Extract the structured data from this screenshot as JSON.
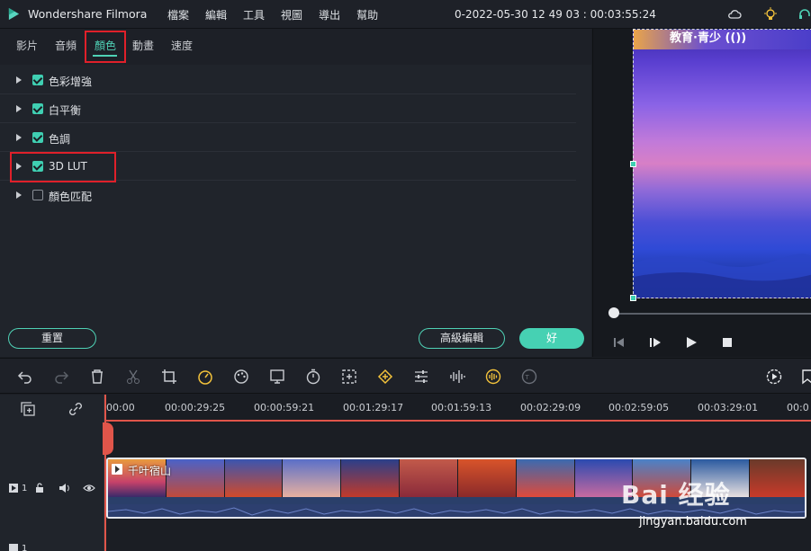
{
  "app": {
    "name": "Wondershare Filmora",
    "project_title": "0-2022-05-30 12 49 03 : 00:03:55:24"
  },
  "menu": [
    "檔案",
    "編輯",
    "工具",
    "視圖",
    "導出",
    "幫助"
  ],
  "tabs": [
    {
      "label": "影片",
      "active": false
    },
    {
      "label": "音頻",
      "active": false
    },
    {
      "label": "顏色",
      "active": true
    },
    {
      "label": "動畫",
      "active": false
    },
    {
      "label": "速度",
      "active": false
    }
  ],
  "adjustments": [
    {
      "label": "色彩增強",
      "checked": true
    },
    {
      "label": "白平衡",
      "checked": true
    },
    {
      "label": "色調",
      "checked": true
    },
    {
      "label": "3D LUT",
      "checked": true
    },
    {
      "label": "顏色匹配",
      "checked": false
    }
  ],
  "buttons": {
    "reset": "重置",
    "advanced": "高級編輯",
    "ok": "好"
  },
  "preview": {
    "banner_text": "教育·青少 (())"
  },
  "timeline": {
    "ruler_labels": [
      "00:00",
      "00:00:29:25",
      "00:00:59:21",
      "00:01:29:17",
      "00:01:59:13",
      "00:02:29:09",
      "00:02:59:05",
      "00:03:29:01",
      "00:0"
    ],
    "clip_title": "千叶宿山",
    "track_labels": [
      "1",
      "1"
    ]
  },
  "watermark": {
    "brand": "Bai 经验",
    "url": "jingyan.baidu.com"
  },
  "colors": {
    "accent": "#4fd1b5",
    "highlight": "#e0202a",
    "playhead": "#e0554a"
  }
}
